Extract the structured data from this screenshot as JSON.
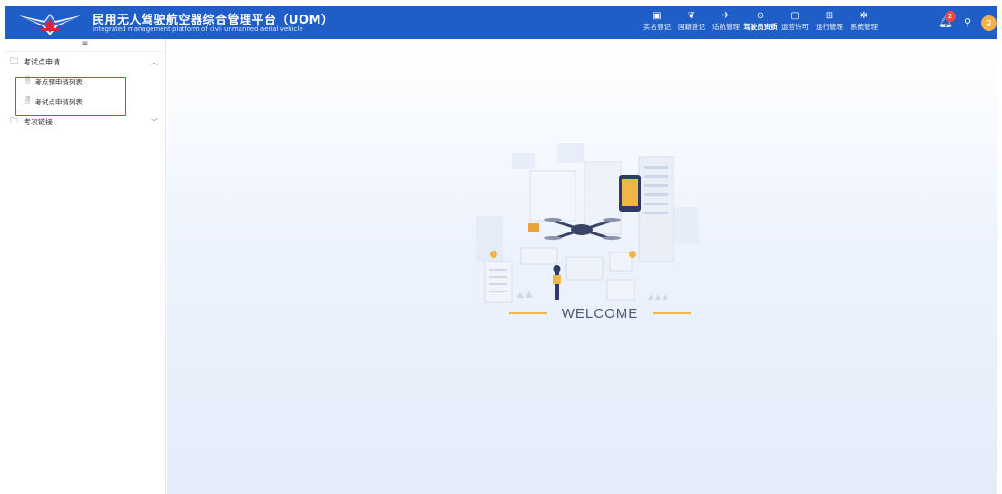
{
  "header": {
    "title_zh": "民用无人驾驶航空器综合管理平台（UOM）",
    "title_en": "Integrated management platform of civil unmanned aerial vehicle",
    "brand_color": "#1f5ec7",
    "nav": [
      {
        "label": "实名登记",
        "icon": "register-icon"
      },
      {
        "label": "国籍登记",
        "icon": "nationality-icon"
      },
      {
        "label": "适航管理",
        "icon": "airworthiness-icon"
      },
      {
        "label": "驾驶员资质",
        "icon": "pilot-qualification-icon",
        "active": true
      },
      {
        "label": "运营许可",
        "icon": "operation-license-icon"
      },
      {
        "label": "运行管理",
        "icon": "operation-management-icon"
      },
      {
        "label": "系统管理",
        "icon": "system-management-icon"
      }
    ],
    "notifications_count": "2",
    "avatar_letter": "g"
  },
  "sidebar": {
    "groups": [
      {
        "label": "考试点申请",
        "expanded": true,
        "items": [
          {
            "label": "考点预申请列表"
          },
          {
            "label": "考试点申请列表"
          }
        ]
      },
      {
        "label": "考次链接",
        "expanded": false,
        "items": []
      }
    ]
  },
  "main": {
    "welcome_text": "WELCOME"
  }
}
